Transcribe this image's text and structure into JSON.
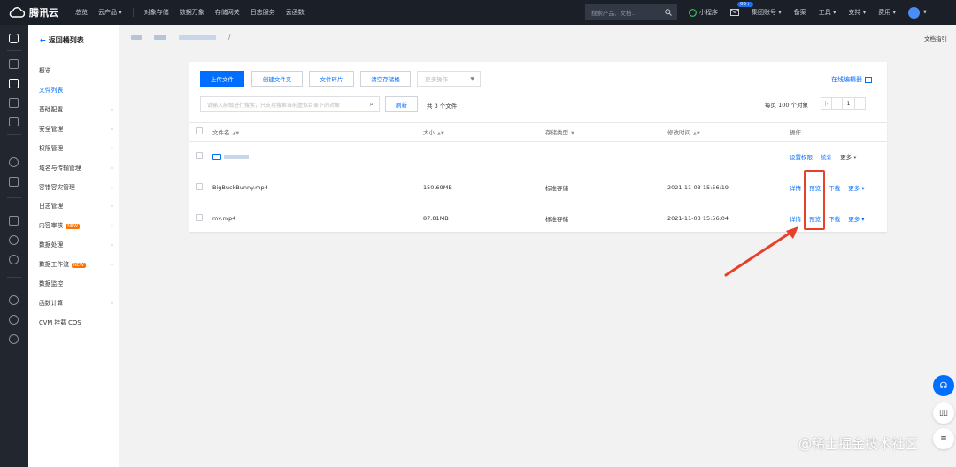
{
  "topbar": {
    "brand": "腾讯云",
    "nav": [
      "总览",
      "云产品 ▾",
      "对象存储",
      "数据万象",
      "存储网关",
      "日志服务",
      "云函数"
    ],
    "search_placeholder": "搜索产品、文档...",
    "mini_program": "小程序",
    "mail_badge": "99+",
    "account": "集团账号 ▾",
    "links": [
      "备案",
      "工具 ▾",
      "支持 ▾",
      "费用 ▾"
    ]
  },
  "sidemenu": {
    "back_label": "返回桶列表",
    "items": [
      {
        "label": "概览",
        "chevron": false,
        "active": false,
        "new": false
      },
      {
        "label": "文件列表",
        "chevron": false,
        "active": true,
        "new": false
      },
      {
        "label": "基础配置",
        "chevron": true,
        "active": false,
        "new": false
      },
      {
        "label": "安全管理",
        "chevron": true,
        "active": false,
        "new": false
      },
      {
        "label": "权限管理",
        "chevron": true,
        "active": false,
        "new": false
      },
      {
        "label": "域名与传输管理",
        "chevron": true,
        "active": false,
        "new": false
      },
      {
        "label": "容错容灾管理",
        "chevron": true,
        "active": false,
        "new": false
      },
      {
        "label": "日志管理",
        "chevron": true,
        "active": false,
        "new": false
      },
      {
        "label": "内容审核",
        "chevron": true,
        "active": false,
        "new": true
      },
      {
        "label": "数据处理",
        "chevron": true,
        "active": false,
        "new": false
      },
      {
        "label": "数据工作流",
        "chevron": true,
        "active": false,
        "new": true
      },
      {
        "label": "数据监控",
        "chevron": false,
        "active": false,
        "new": false
      },
      {
        "label": "函数计算",
        "chevron": true,
        "active": false,
        "new": false
      },
      {
        "label": "CVM 挂载 COS",
        "chevron": false,
        "active": false,
        "new": false
      }
    ],
    "new_tag": "NEW"
  },
  "breadcrumb": {
    "separator": "/"
  },
  "doc_guide": "文档指引",
  "toolbar": {
    "upload": "上传文件",
    "create_folder": "创建文件夹",
    "fragments": "文件碎片",
    "clear_bucket": "清空存储桶",
    "more_ops": "更多操作",
    "online_editor": "在线编辑器",
    "search_placeholder": "请输入前缀进行搜索，只支持搜索当前虚拟目录下的对象",
    "refresh": "刷新",
    "total": "共 3 个文件",
    "per_page": "每页 100 个对象",
    "page": "1"
  },
  "table": {
    "headers": [
      "文件名",
      "大小",
      "存储类型",
      "修改时间",
      "操作"
    ],
    "rows": [
      {
        "name": "",
        "size": "-",
        "storage": "-",
        "modified": "-",
        "ops": [
          "设置权限",
          "统计",
          "更多 ▾"
        ],
        "folder": true
      },
      {
        "name": "BigBuckBunny.mp4",
        "size": "150.69MB",
        "storage": "标准存储",
        "modified": "2021-11-03 15:56:19",
        "ops": [
          "详情",
          "预览",
          "下载",
          "更多 ▾"
        ],
        "folder": false
      },
      {
        "name": "mv.mp4",
        "size": "87.81MB",
        "storage": "标准存储",
        "modified": "2021-11-03 15:56:04",
        "ops": [
          "详情",
          "预览",
          "下载",
          "更多 ▾"
        ],
        "folder": false
      }
    ]
  },
  "watermark": "@稀土掘金技术社区",
  "colors": {
    "accent": "#006eff",
    "annotation": "#e8412a",
    "topbar": "#1b1f27"
  }
}
